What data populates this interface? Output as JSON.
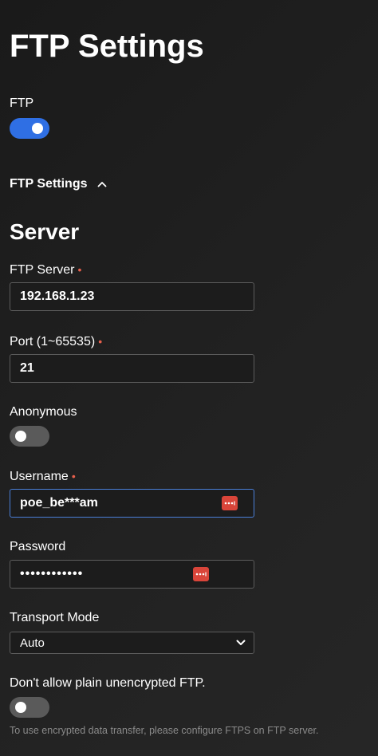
{
  "page": {
    "title": "FTP Settings"
  },
  "ftp": {
    "label": "FTP",
    "enabled": true
  },
  "section": {
    "toggle_label": "FTP Settings",
    "expanded": true,
    "heading": "Server"
  },
  "fields": {
    "server": {
      "label": "FTP Server",
      "required": "•",
      "value": "192.168.1.23"
    },
    "port": {
      "label": "Port (1~65535)",
      "required": "•",
      "value": "21"
    },
    "anonymous": {
      "label": "Anonymous",
      "enabled": false
    },
    "username": {
      "label": "Username",
      "required": "•",
      "value": "poe_be***am",
      "focused": true
    },
    "password": {
      "label": "Password",
      "value": "••••••••••••"
    },
    "transport_mode": {
      "label": "Transport Mode",
      "selected": "Auto"
    },
    "no_plain_ftp": {
      "label": "Don't allow plain unencrypted FTP.",
      "enabled": false,
      "hint": "To use encrypted data transfer, please configure FTPS on FTP server."
    }
  },
  "icons": {
    "password_manager": "password-manager-icon",
    "chevron_up": "chevron-up-icon",
    "chevron_down": "chevron-down-icon"
  },
  "colors": {
    "background": "#1e1e1e",
    "accent": "#2f6fe4",
    "required": "#e8604c",
    "password_manager": "#d9453a",
    "toggle_off": "#5a5a5a",
    "focus_border": "#4a7fd9"
  }
}
